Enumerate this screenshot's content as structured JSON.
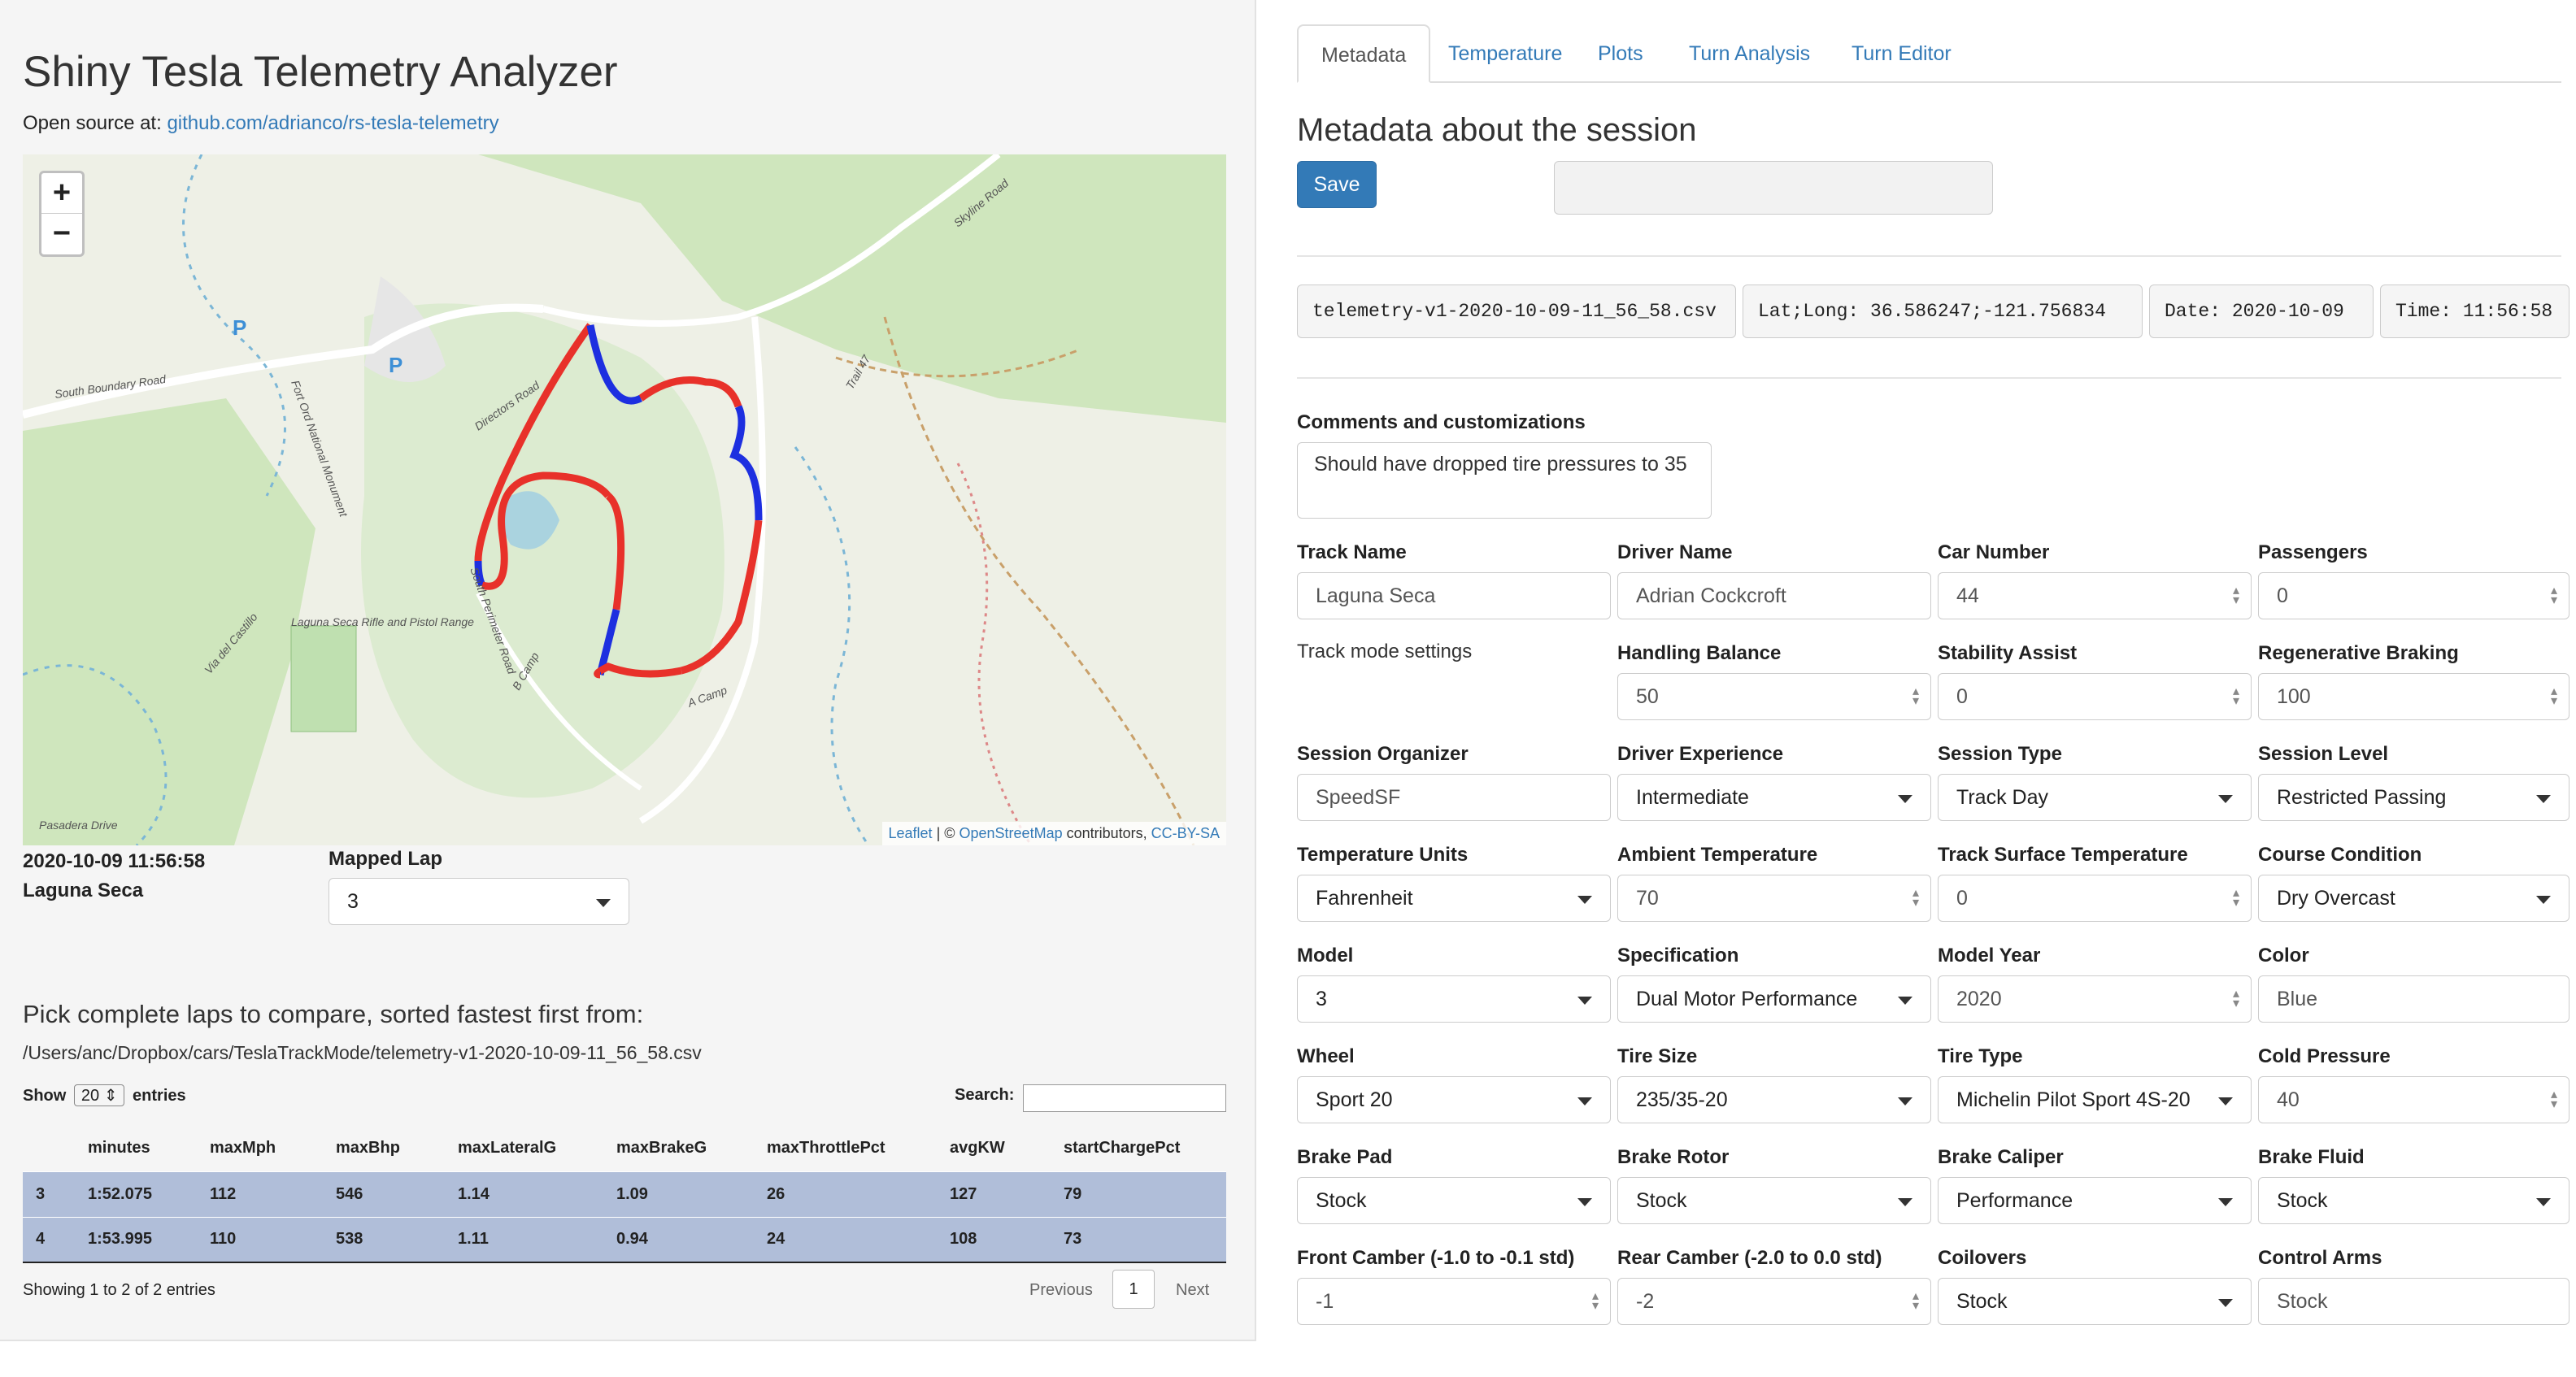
{
  "app": {
    "title": "Shiny Tesla Telemetry Analyzer",
    "source_prefix": "Open source at:",
    "source_link": "github.com/adrianco/rs-tesla-telemetry"
  },
  "map": {
    "zoom_in": "+",
    "zoom_out": "−",
    "attribution_leaflet": "Leaflet",
    "attribution_mid": " | © ",
    "attribution_osm": "OpenStreetMap",
    "attribution_contrib": " contributors, ",
    "attribution_license": "CC-BY-SA",
    "labels": [
      "South Boundary Road",
      "Fort Ord National Monument",
      "Laguna Seca Rifle and Pistol Range",
      "South Perimeter Road",
      "Directors Road",
      "Skyline Road",
      "Trail 47",
      "A Camp",
      "B Camp",
      "Via del Castillo",
      "Pasadera Drive"
    ],
    "track_colors": {
      "fast": "#e8312a",
      "slow": "#1d2fe0"
    }
  },
  "session": {
    "datetime": "2020-10-09 11:56:58",
    "track": "Laguna Seca",
    "mapped_lap_label": "Mapped Lap",
    "mapped_lap_value": "3"
  },
  "laps": {
    "heading": "Pick complete laps to compare, sorted fastest first from:",
    "path": "/Users/anc/Dropbox/cars/TeslaTrackMode/telemetry-v1-2020-10-09-11_56_58.csv",
    "show_label": "Show",
    "show_value": "20",
    "entries_label": "entries",
    "search_label": "Search:",
    "columns": [
      "",
      "minutes",
      "maxMph",
      "maxBhp",
      "maxLateralG",
      "maxBrakeG",
      "maxThrottlePct",
      "avgKW",
      "startChargePct"
    ],
    "rows": [
      [
        "3",
        "1:52.075",
        "112",
        "546",
        "1.14",
        "1.09",
        "26",
        "127",
        "79"
      ],
      [
        "4",
        "1:53.995",
        "110",
        "538",
        "1.11",
        "0.94",
        "24",
        "108",
        "73"
      ]
    ],
    "info": "Showing 1 to 2 of 2 entries",
    "prev": "Previous",
    "page": "1",
    "next": "Next"
  },
  "tabs": [
    "Metadata",
    "Temperature",
    "Plots",
    "Turn Analysis",
    "Turn Editor"
  ],
  "metadata": {
    "heading": "Metadata about the session",
    "save": "Save",
    "file": "telemetry-v1-2020-10-09-11_56_58.csv",
    "latlong": "Lat;Long: 36.586247;-121.756834",
    "date": "Date: 2020-10-09",
    "time": "Time: 11:56:58",
    "comments_label": "Comments and customizations",
    "comments_value": "Should have dropped tire pressures to 35",
    "track_mode_label": "Track mode settings",
    "fields": {
      "track_name": {
        "label": "Track Name",
        "value": "Laguna Seca"
      },
      "driver_name": {
        "label": "Driver Name",
        "value": "Adrian Cockcroft"
      },
      "car_number": {
        "label": "Car Number",
        "value": "44"
      },
      "passengers": {
        "label": "Passengers",
        "value": "0"
      },
      "handling_balance": {
        "label": "Handling Balance",
        "value": "50"
      },
      "stability_assist": {
        "label": "Stability Assist",
        "value": "0"
      },
      "regen_braking": {
        "label": "Regenerative Braking",
        "value": "100"
      },
      "session_organizer": {
        "label": "Session Organizer",
        "value": "SpeedSF"
      },
      "driver_experience": {
        "label": "Driver Experience",
        "value": "Intermediate"
      },
      "session_type": {
        "label": "Session Type",
        "value": "Track Day"
      },
      "session_level": {
        "label": "Session Level",
        "value": "Restricted Passing"
      },
      "temp_units": {
        "label": "Temperature Units",
        "value": "Fahrenheit"
      },
      "ambient_temp": {
        "label": "Ambient Temperature",
        "value": "70"
      },
      "surface_temp": {
        "label": "Track Surface Temperature",
        "value": "0"
      },
      "course_condition": {
        "label": "Course Condition",
        "value": "Dry Overcast"
      },
      "model": {
        "label": "Model",
        "value": "3"
      },
      "specification": {
        "label": "Specification",
        "value": "Dual Motor Performance"
      },
      "model_year": {
        "label": "Model Year",
        "value": "2020"
      },
      "color": {
        "label": "Color",
        "value": "Blue"
      },
      "wheel": {
        "label": "Wheel",
        "value": "Sport 20"
      },
      "tire_size": {
        "label": "Tire Size",
        "value": "235/35-20"
      },
      "tire_type": {
        "label": "Tire Type",
        "value": "Michelin Pilot Sport 4S-20"
      },
      "cold_pressure": {
        "label": "Cold Pressure",
        "value": "40"
      },
      "brake_pad": {
        "label": "Brake Pad",
        "value": "Stock"
      },
      "brake_rotor": {
        "label": "Brake Rotor",
        "value": "Stock"
      },
      "brake_caliper": {
        "label": "Brake Caliper",
        "value": "Performance"
      },
      "brake_fluid": {
        "label": "Brake Fluid",
        "value": "Stock"
      },
      "front_camber": {
        "label": "Front Camber (-1.0 to -0.1 std)",
        "value": "-1"
      },
      "rear_camber": {
        "label": "Rear Camber (-2.0 to 0.0 std)",
        "value": "-2"
      },
      "coilovers": {
        "label": "Coilovers",
        "value": "Stock"
      },
      "control_arms": {
        "label": "Control Arms",
        "value": "Stock"
      }
    }
  }
}
